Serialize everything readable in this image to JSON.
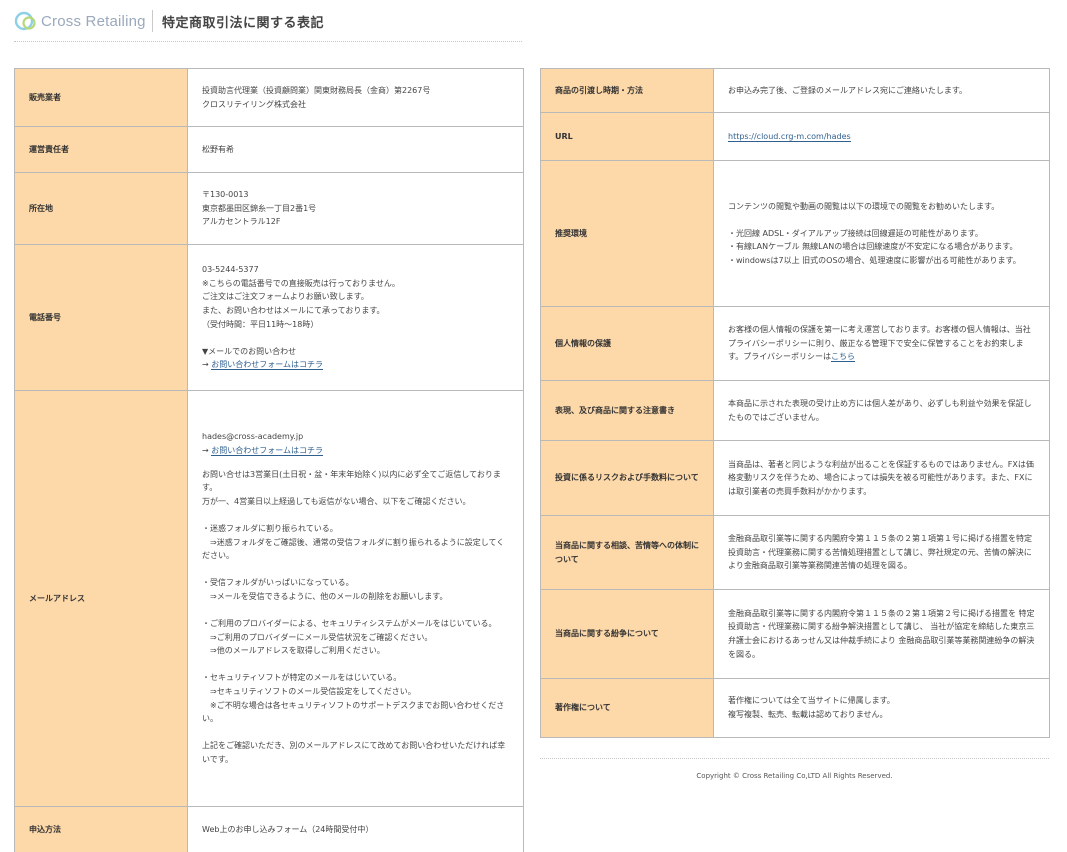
{
  "header": {
    "logo_text": "Cross Retailing",
    "page_title": "特定商取引法に関する表記"
  },
  "left": [
    {
      "label": "販売業者",
      "value": "投資助言代理業（投資顧問業）関東財務局長（金商）第2267号\nクロスリテイリング株式会社"
    },
    {
      "label": "運営責任者",
      "value": "松野有希"
    },
    {
      "label": "所在地",
      "value": "〒130-0013\n東京都墨田区錦糸一丁目2番1号\nアルカセントラル12F"
    },
    {
      "label": "電話番号",
      "value": "03-5244-5377\n※こちらの電話番号での直接販売は行っておりません。\nご注文はご注文フォームよりお願い致します。\nまた、お問い合わせはメールにて承っております。\n（受付時間：平日11時～18時）\n\n▼メールでのお問い合わせ",
      "link_prefix": "→ ",
      "link_text": "お問い合わせフォームはコチラ"
    },
    {
      "label": "メールアドレス",
      "email": "hades@cross-academy.jp",
      "link_prefix": "→ ",
      "link_text": "お問い合わせフォームはコチラ",
      "value": "お問い合せは3営業日(土日祝・盆・年末年始除く)以内に必ず全てご返信しております。\n万が一、4営業日以上経過しても返信がない場合、以下をご確認ください。\n\n・迷惑フォルダに割り振られている。\n　⇒迷惑フォルダをご確認後、通常の受信フォルダに割り振られるように設定してください。\n\n・受信フォルダがいっぱいになっている。\n　⇒メールを受信できるように、他のメールの削除をお願いします。\n\n・ご利用のプロバイダーによる、セキュリティシステムがメールをはじいている。\n　⇒ご利用のプロバイダーにメール受信状況をご確認ください。\n　⇒他のメールアドレスを取得しご利用ください。\n\n・セキュリティソフトが特定のメールをはじいている。\n　⇒セキュリティソフトのメール受信設定をしてください。\n　※ご不明な場合は各セキュリティソフトのサポートデスクまでお問い合わせください。\n\n上記をご確認いただき、別のメールアドレスにて改めてお問い合わせいただければ幸いです。"
    },
    {
      "label": "申込方法",
      "value": "Web上のお申し込みフォーム（24時間受付中）"
    }
  ],
  "right": [
    {
      "label": "商品の引渡し時期・方法",
      "value": "お申込み完了後、ご登録のメールアドレス宛にご連絡いたします。"
    },
    {
      "label": "URL",
      "link_text": "https://cloud.crg-m.com/hades"
    },
    {
      "label": "推奨環境",
      "value": "コンテンツの閲覧や動画の閲覧は以下の環境での閲覧をお勧めいたします。\n\n・光回線 ADSL・ダイアルアップ接続は回線遅延の可能性があります。\n・有線LANケーブル 無線LANの場合は回線速度が不安定になる場合があります。\n・windowsは7以上 旧式のOSの場合、処理速度に影響が出る可能性があります。"
    },
    {
      "label": "個人情報の保護",
      "value": "お客様の個人情報の保護を第一に考え運営しております。お客様の個人情報は、当社プライバシーポリシーに則り、厳正なる管理下で安全に保管することをお約束します。プライバシーポリシーは",
      "link_text": "こちら"
    },
    {
      "label": "表現、及び商品に関する注意書き",
      "value": "本商品に示された表現の受け止め方には個人差があり、必ずしも利益や効果を保証したものではございません。"
    },
    {
      "label": "投資に係るリスクおよび手数料について",
      "value": "当商品は、著者と同じような利益が出ることを保証するものではありません。FXは価格変動リスクを伴うため、場合によっては損失を被る可能性があります。また、FXには取引業者の売買手数料がかかります。"
    },
    {
      "label": "当商品に関する相談、苦情等への体制について",
      "value": "金融商品取引業等に関する内閣府令第１１５条の２第１項第１号に掲げる措置を特定投資助言・代理業務に関する苦情処理措置として講じ、弊社規定の元、苦情の解決により金融商品取引業等業務関連苦情の処理を図る。"
    },
    {
      "label": "当商品に関する紛争について",
      "value": "金融商品取引業等に関する内閣府令第１１５条の２第１項第２号に掲げる措置を 特定投資助言・代理業務に関する紛争解決措置として講じ、 当社が協定を締結した東京三弁護士会におけるあっせん又は仲裁手続により 金融商品取引業等業務関連紛争の解決を図る。"
    },
    {
      "label": "著作権について",
      "value": "著作権については全て当サイトに帰属します。\n複写複製、転売、転載は認めておりません。"
    }
  ],
  "footer": {
    "copyright": "Copyright © Cross Retailing Co,LTD All Rights Reserved."
  },
  "colors": {
    "label_bg": "#fdd8a9",
    "border": "#b9b9b9",
    "link": "#2f5f8f",
    "logo_text": "#9aa9bc"
  }
}
